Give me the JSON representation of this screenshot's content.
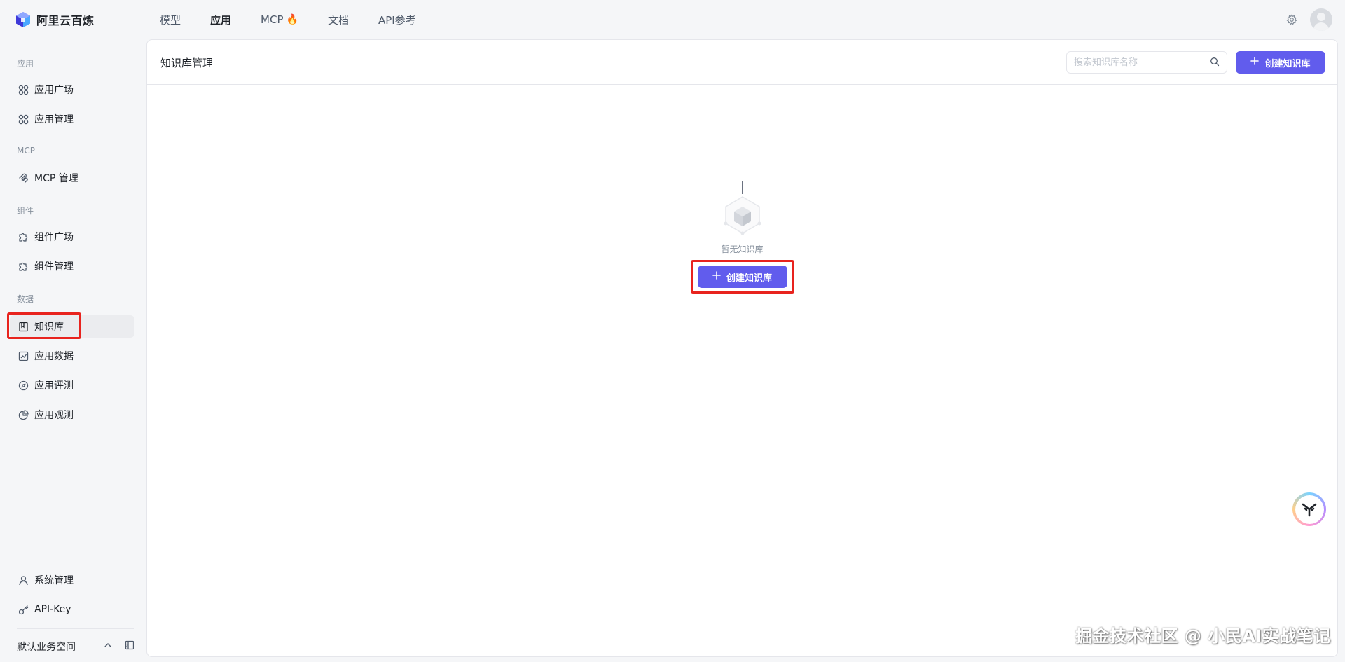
{
  "brand": {
    "name": "阿里云百炼",
    "logo_icon": "bailian-logo-icon"
  },
  "topnav": {
    "items": [
      {
        "label": "模型",
        "active": false
      },
      {
        "label": "应用",
        "active": true
      },
      {
        "label": "MCP",
        "active": false,
        "badge_icon": "fire-icon"
      },
      {
        "label": "文档",
        "active": false
      },
      {
        "label": "API参考",
        "active": false
      }
    ],
    "fire_glyph": "🔥"
  },
  "sidebar": {
    "groups": {
      "app": "应用",
      "mcp": "MCP",
      "component": "组件",
      "data": "数据"
    },
    "items": {
      "app_square": "应用广场",
      "app_manage": "应用管理",
      "mcp_manage": "MCP 管理",
      "comp_square": "组件广场",
      "comp_manage": "组件管理",
      "knowledge": "知识库",
      "app_data": "应用数据",
      "app_eval": "应用评测",
      "app_observe": "应用观测",
      "system_manage": "系统管理",
      "api_key": "API-Key"
    },
    "active_item": "knowledge",
    "workspace": "默认业务空间"
  },
  "main": {
    "title": "知识库管理",
    "search": {
      "placeholder": "搜索知识库名称",
      "value": ""
    },
    "create_label": "创建知识库",
    "empty_text": "暂无知识库"
  },
  "colors": {
    "primary": "#615ced",
    "highlight": "#e8231e",
    "background": "#f5f6f8"
  },
  "watermark": "掘金技术社区 @ 小民AI实战笔记"
}
